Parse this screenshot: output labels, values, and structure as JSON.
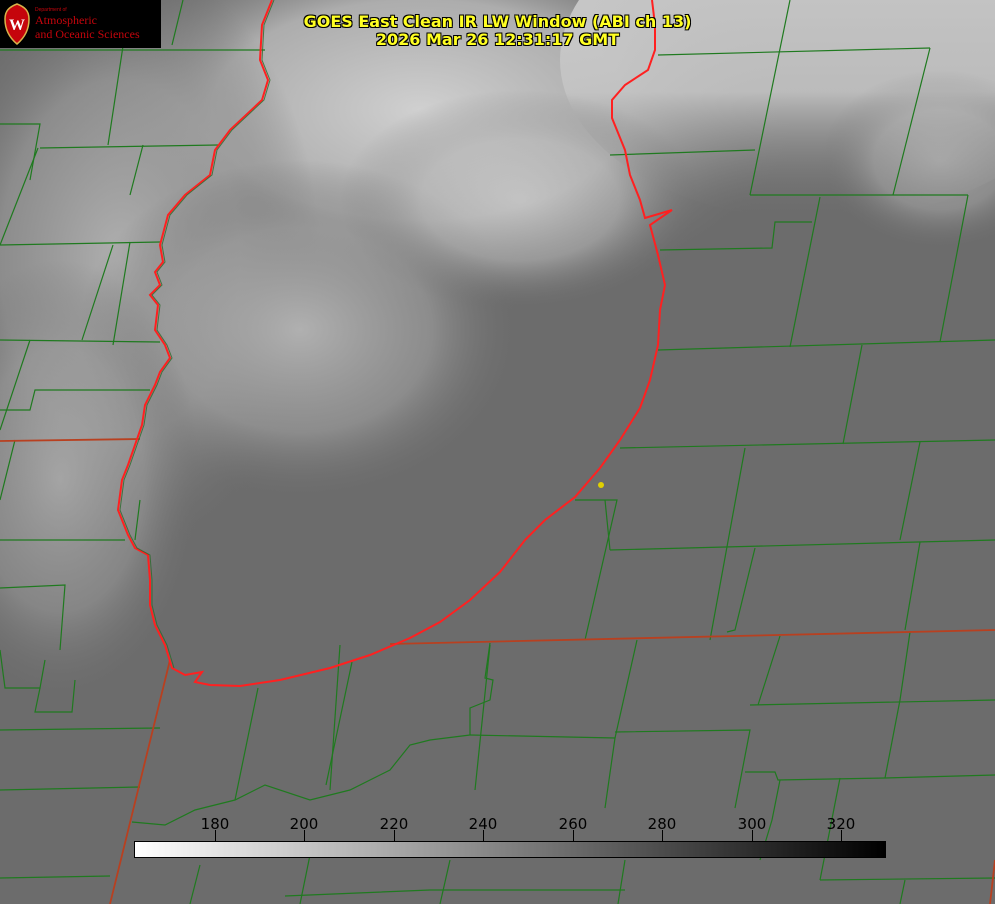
{
  "title": {
    "line1": "GOES East Clean IR LW Window (ABI ch 13)",
    "line2": "2026 Mar 26 12:31:17 GMT"
  },
  "logo": {
    "dept": "Department of",
    "line1": "Atmospheric",
    "line2": "and Oceanic Sciences",
    "shield_letter": "W",
    "color": "#c5050c"
  },
  "colorbar": {
    "ticks": [
      "180",
      "200",
      "220",
      "240",
      "260",
      "280",
      "300",
      "320"
    ],
    "range": [
      162,
      330
    ],
    "gradient": [
      "#ffffff",
      "#000000"
    ]
  },
  "colors": {
    "county_lines": "#1f7a1f",
    "state_lines": "#b84020",
    "lake_outline": "#ff2020",
    "marker": "#e0d000",
    "title": "#ffff22"
  }
}
